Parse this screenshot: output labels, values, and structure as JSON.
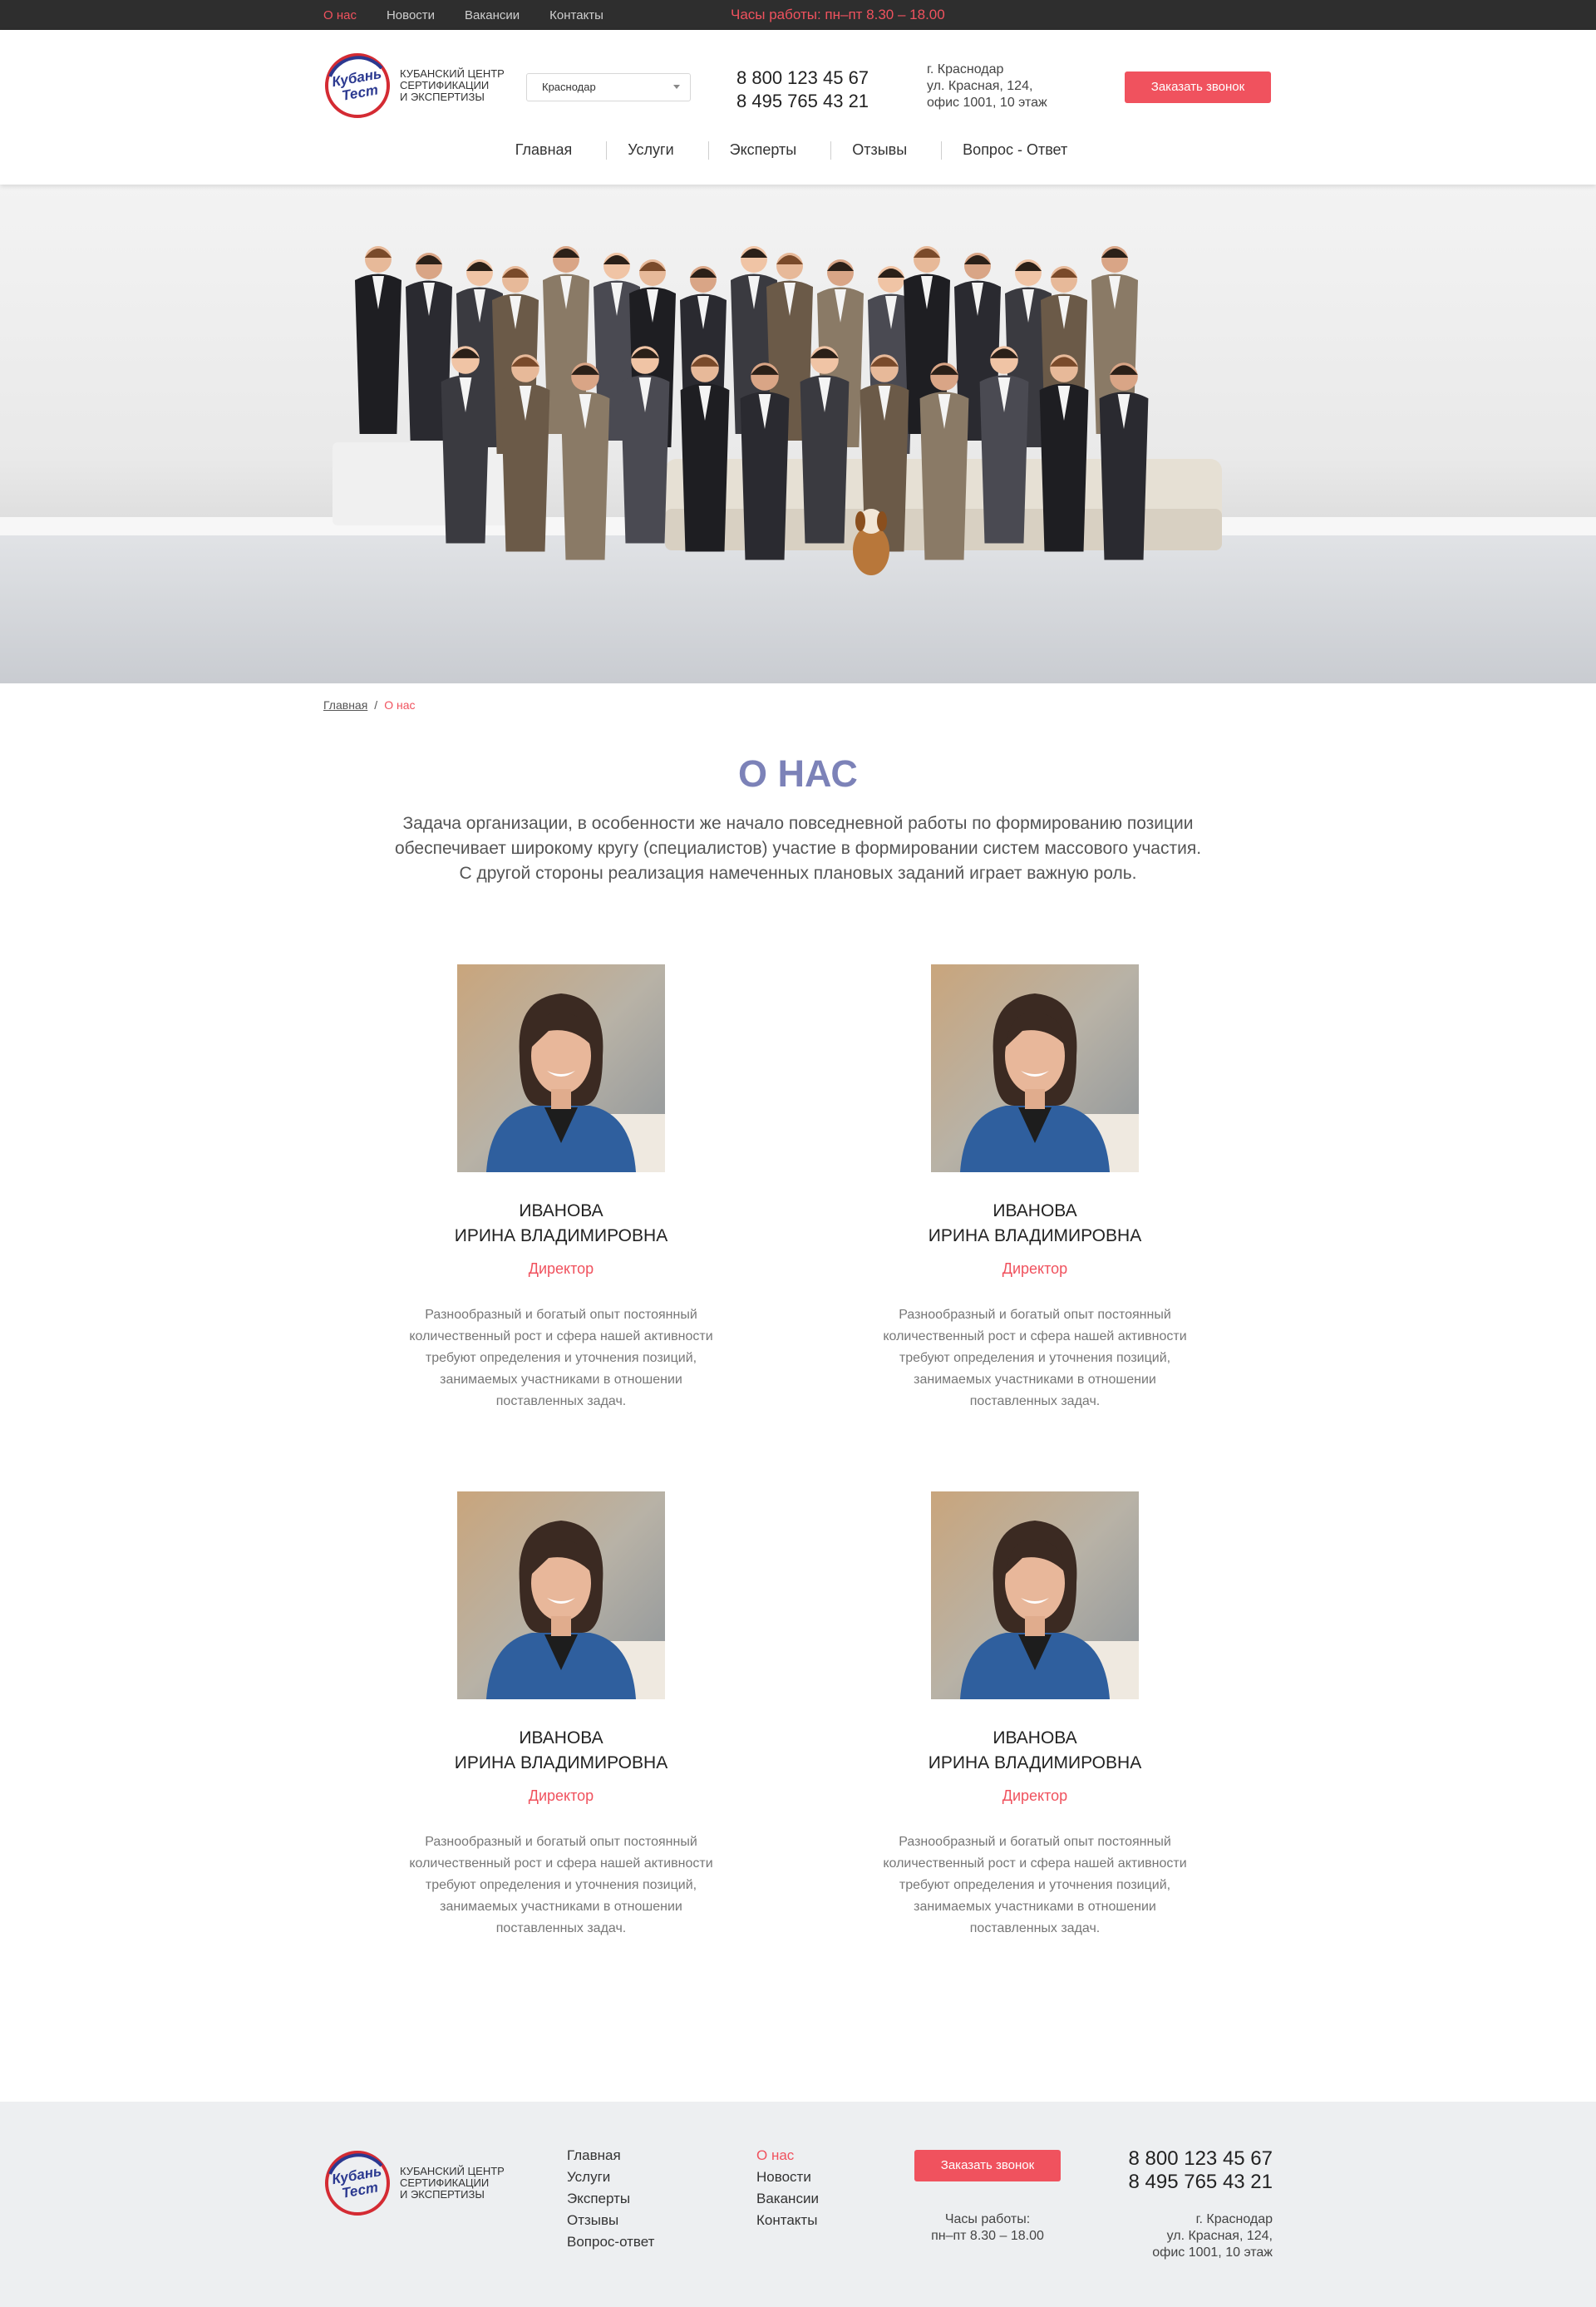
{
  "topbar": {
    "links": [
      {
        "label": "О нас",
        "active": true
      },
      {
        "label": "Новости",
        "active": false
      },
      {
        "label": "Вакансии",
        "active": false
      },
      {
        "label": "Контакты",
        "active": false
      }
    ],
    "hours": "Часы работы: пн–пт 8.30 – 18.00"
  },
  "header": {
    "logo_text_line1": "КУБАНСКИЙ ЦЕНТР",
    "logo_text_line2": "СЕРТИФИКАЦИИ",
    "logo_text_line3": "И ЭКСПЕРТИЗЫ",
    "logo_word1": "Кубань",
    "logo_word2": "Тест",
    "city": "Краснодар",
    "phone1": "8 800 123 45 67",
    "phone2": "8 495 765 43 21",
    "address_line1": "г. Краснодар",
    "address_line2": "ул. Красная, 124,",
    "address_line3": "офис 1001, 10 этаж",
    "call_button": "Заказать звонок"
  },
  "mainnav": [
    "Главная",
    "Услуги",
    "Эксперты",
    "Отзывы",
    "Вопрос - Ответ"
  ],
  "breadcrumb": {
    "home": "Главная",
    "separator": "/",
    "current": "О нас"
  },
  "page": {
    "title": "О НАС",
    "intro_line1": "Задача организации, в особенности же начало повседневной работы по формированию позиции",
    "intro_line2": "обеспечивает широкому кругу (специалистов) участие в формировании систем массового участия.",
    "intro_line3": "С другой стороны реализация намеченных плановых заданий играет важную роль."
  },
  "experts": [
    {
      "surname": "ИВАНОВА",
      "name": "ИРИНА ВЛАДИМИРОВНА",
      "position": "Директор",
      "desc": [
        "Разнообразный и богатый опыт постоянный",
        "количественный рост и сфера нашей активности",
        "требуют определения и уточнения позиций,",
        "занимаемых участниками в отношении",
        "поставленных задач."
      ]
    },
    {
      "surname": "ИВАНОВА",
      "name": "ИРИНА ВЛАДИМИРОВНА",
      "position": "Директор",
      "desc": [
        "Разнообразный и богатый опыт постоянный",
        "количественный рост и сфера нашей активности",
        "требуют определения и уточнения позиций,",
        "занимаемых участниками в отношении",
        "поставленных задач."
      ]
    },
    {
      "surname": "ИВАНОВА",
      "name": "ИРИНА ВЛАДИМИРОВНА",
      "position": "Директор",
      "desc": [
        "Разнообразный и богатый опыт постоянный",
        "количественный рост и сфера нашей активности",
        "требуют определения и уточнения позиций,",
        "занимаемых участниками в отношении",
        "поставленных задач."
      ]
    },
    {
      "surname": "ИВАНОВА",
      "name": "ИРИНА ВЛАДИМИРОВНА",
      "position": "Директор",
      "desc": [
        "Разнообразный и богатый опыт постоянный",
        "количественный рост и сфера нашей активности",
        "требуют определения и уточнения позиций,",
        "занимаемых участниками в отношении",
        "поставленных задач."
      ]
    }
  ],
  "footer": {
    "nav1": [
      "Главная",
      "Услуги",
      "Эксперты",
      "Отзывы",
      "Вопрос-ответ"
    ],
    "nav2": [
      "О нас",
      "Новости",
      "Вакансии",
      "Контакты"
    ],
    "call_button": "Заказать звонок",
    "hours_line1": "Часы работы:",
    "hours_line2": "пн–пт 8.30 – 18.00",
    "phone1": "8 800 123 45 67",
    "phone2": "8 495 765 43 21",
    "address_line1": "г. Краснодар",
    "address_line2": "ул. Красная, 124,",
    "address_line3": "офис 1001, 10 этаж"
  },
  "colors": {
    "accent": "#f0525e",
    "title": "#7c82b8",
    "topbar": "#2e2e2e",
    "footer_bg": "#edeff1"
  }
}
